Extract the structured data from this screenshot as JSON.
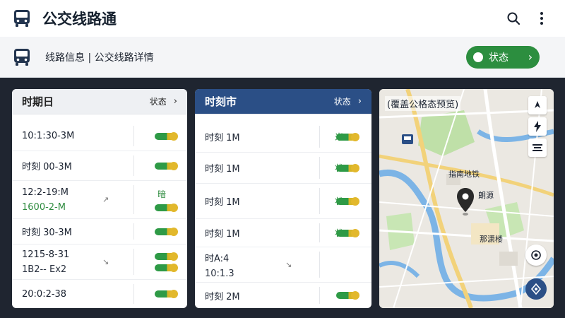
{
  "app": {
    "title": "公交线路通"
  },
  "subheader": {
    "breadcrumb": "线路信息 | 公交线路详情",
    "status_button": "状态"
  },
  "schedule_card": {
    "title": "时期日",
    "status": "状态",
    "rows": [
      {
        "line1": "10:1:30-3M",
        "line2": ""
      },
      {
        "line1": "时刻 00-3M",
        "line2": ""
      },
      {
        "line1": "12:2-19:M",
        "line2": "1600-2-M",
        "mini": "暗"
      },
      {
        "line1": "时刻 30-3M",
        "line2": ""
      },
      {
        "line1": "1215-8-31",
        "line2": "1B2-- Ex2"
      },
      {
        "line1": "20:0:2-38",
        "line2": ""
      }
    ]
  },
  "timetable_card": {
    "title": "时刻市",
    "status": "状态",
    "rows": [
      {
        "line1": "时刻 1M",
        "line2": "",
        "label": "米"
      },
      {
        "line1": "时刻 1M",
        "line2": "",
        "label": "状"
      },
      {
        "line1": "时刻 1M",
        "line2": "",
        "label": "状"
      },
      {
        "line1": "时刻 1M",
        "line2": "",
        "label": "状"
      },
      {
        "line1": "时A:4",
        "line2": "10:1.3",
        "label": ""
      },
      {
        "line1": "时刻 2M",
        "line2": "",
        "label": ""
      }
    ]
  },
  "map": {
    "title": "(覆盖公格态预览)",
    "labels": [
      "指南地铁",
      "朗源",
      "那潇楼"
    ],
    "colors": {
      "water": "#7cb4e6",
      "park": "#bfe0a8",
      "road_major": "#f2d27a"
    }
  },
  "colors": {
    "accent": "#2c8e3f",
    "header_blue": "#2b4f86",
    "toggle_green": "#2e9a46",
    "toggle_yellow": "#e2b82c"
  }
}
